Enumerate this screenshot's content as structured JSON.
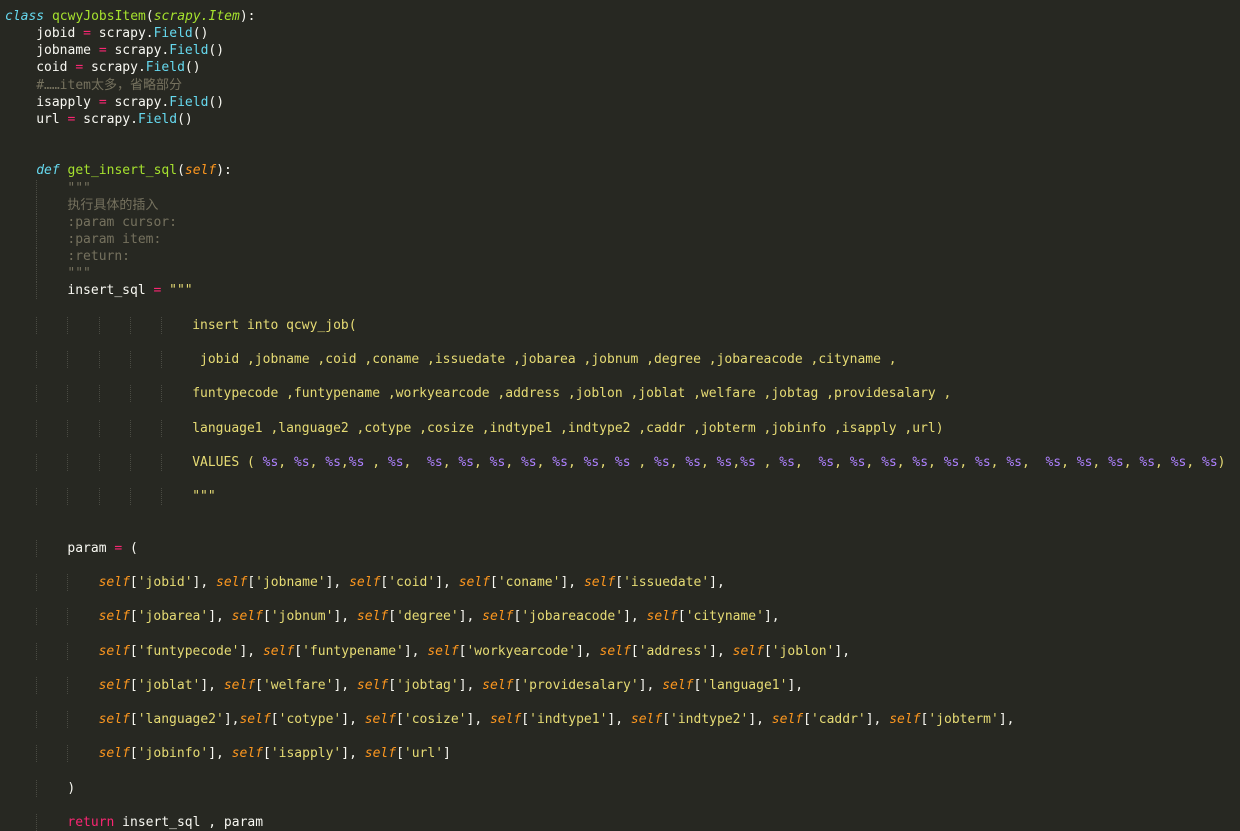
{
  "theme": {
    "background": "#272822",
    "foreground": "#f8f8f2",
    "keyword": "#66d9ef",
    "class_name": "#a6e22e",
    "operator": "#f92672",
    "comment": "#75715e",
    "self": "#fd971f",
    "string": "#e6db74",
    "format_spec": "#ae81ff"
  },
  "lines": [
    {
      "indent": 0,
      "tokens": [
        {
          "t": "class",
          "k": "kw"
        },
        {
          "t": " ",
          "k": "plain"
        },
        {
          "t": "qcwyJobsItem",
          "k": "cls"
        },
        {
          "t": "(",
          "k": "plain"
        },
        {
          "t": "scrapy.Item",
          "k": "base"
        },
        {
          "t": "):",
          "k": "plain"
        }
      ]
    },
    {
      "indent": 4,
      "tokens": [
        {
          "t": "jobid ",
          "k": "plain"
        },
        {
          "t": "=",
          "k": "op"
        },
        {
          "t": " scrapy.",
          "k": "plain"
        },
        {
          "t": "Field",
          "k": "call"
        },
        {
          "t": "()",
          "k": "plain"
        }
      ]
    },
    {
      "indent": 4,
      "tokens": [
        {
          "t": "jobname ",
          "k": "plain"
        },
        {
          "t": "=",
          "k": "op"
        },
        {
          "t": " scrapy.",
          "k": "plain"
        },
        {
          "t": "Field",
          "k": "call"
        },
        {
          "t": "()",
          "k": "plain"
        }
      ]
    },
    {
      "indent": 4,
      "tokens": [
        {
          "t": "coid ",
          "k": "plain"
        },
        {
          "t": "=",
          "k": "op"
        },
        {
          "t": " scrapy.",
          "k": "plain"
        },
        {
          "t": "Field",
          "k": "call"
        },
        {
          "t": "()",
          "k": "plain"
        }
      ]
    },
    {
      "indent": 4,
      "tokens": [
        {
          "t": "#……item太多，省略部分",
          "k": "cmt"
        }
      ]
    },
    {
      "indent": 4,
      "tokens": [
        {
          "t": "isapply ",
          "k": "plain"
        },
        {
          "t": "=",
          "k": "op"
        },
        {
          "t": " scrapy.",
          "k": "plain"
        },
        {
          "t": "Field",
          "k": "call"
        },
        {
          "t": "()",
          "k": "plain"
        }
      ]
    },
    {
      "indent": 4,
      "tokens": [
        {
          "t": "url ",
          "k": "plain"
        },
        {
          "t": "=",
          "k": "op"
        },
        {
          "t": " scrapy.",
          "k": "plain"
        },
        {
          "t": "Field",
          "k": "call"
        },
        {
          "t": "()",
          "k": "plain"
        }
      ]
    },
    {
      "indent": 0,
      "tokens": []
    },
    {
      "indent": 0,
      "tokens": []
    },
    {
      "indent": 4,
      "tokens": [
        {
          "t": "def",
          "k": "kw"
        },
        {
          "t": " ",
          "k": "plain"
        },
        {
          "t": "get_insert_sql",
          "k": "fn"
        },
        {
          "t": "(",
          "k": "plain"
        },
        {
          "t": "self",
          "k": "self"
        },
        {
          "t": "):",
          "k": "plain"
        }
      ]
    },
    {
      "indent": 8,
      "tokens": [
        {
          "t": "\"\"\"",
          "k": "doc"
        }
      ]
    },
    {
      "indent": 8,
      "tokens": [
        {
          "t": "执行具体的插入",
          "k": "doc"
        }
      ]
    },
    {
      "indent": 8,
      "tokens": [
        {
          "t": ":param cursor:",
          "k": "doc"
        }
      ]
    },
    {
      "indent": 8,
      "tokens": [
        {
          "t": ":param item:",
          "k": "doc"
        }
      ]
    },
    {
      "indent": 8,
      "tokens": [
        {
          "t": ":return:",
          "k": "doc"
        }
      ]
    },
    {
      "indent": 8,
      "tokens": [
        {
          "t": "\"\"\"",
          "k": "doc"
        }
      ]
    },
    {
      "indent": 8,
      "tokens": [
        {
          "t": "insert_sql ",
          "k": "plain"
        },
        {
          "t": "=",
          "k": "op"
        },
        {
          "t": " ",
          "k": "plain"
        },
        {
          "t": "\"\"\"",
          "k": "str"
        }
      ]
    },
    {
      "indent": 0,
      "tokens": []
    },
    {
      "indent": 24,
      "tokens": [
        {
          "t": "insert into qcwy_job(",
          "k": "str"
        }
      ]
    },
    {
      "indent": 0,
      "tokens": []
    },
    {
      "indent": 24,
      "tokens": [
        {
          "t": " jobid ,jobname ,coid ,coname ,issuedate ,jobarea ,jobnum ,degree ,jobareacode ,cityname ,",
          "k": "str"
        }
      ]
    },
    {
      "indent": 0,
      "tokens": []
    },
    {
      "indent": 24,
      "tokens": [
        {
          "t": "funtypecode ,funtypename ,workyearcode ,address ,joblon ,joblat ,welfare ,jobtag ,providesalary ,",
          "k": "str"
        }
      ]
    },
    {
      "indent": 0,
      "tokens": []
    },
    {
      "indent": 24,
      "tokens": [
        {
          "t": "language1 ,language2 ,cotype ,cosize ,indtype1 ,indtype2 ,caddr ,jobterm ,jobinfo ,isapply ,url)",
          "k": "str"
        }
      ]
    },
    {
      "indent": 0,
      "tokens": []
    },
    {
      "indent": 24,
      "tokens": [
        {
          "t": "VALUES ( ",
          "k": "str"
        },
        {
          "t": "%s",
          "k": "fmt"
        },
        {
          "t": ", ",
          "k": "str"
        },
        {
          "t": "%s",
          "k": "fmt"
        },
        {
          "t": ", ",
          "k": "str"
        },
        {
          "t": "%s",
          "k": "fmt"
        },
        {
          "t": ",",
          "k": "str"
        },
        {
          "t": "%s",
          "k": "fmt"
        },
        {
          "t": " , ",
          "k": "str"
        },
        {
          "t": "%s",
          "k": "fmt"
        },
        {
          "t": ",  ",
          "k": "str"
        },
        {
          "t": "%s",
          "k": "fmt"
        },
        {
          "t": ", ",
          "k": "str"
        },
        {
          "t": "%s",
          "k": "fmt"
        },
        {
          "t": ", ",
          "k": "str"
        },
        {
          "t": "%s",
          "k": "fmt"
        },
        {
          "t": ", ",
          "k": "str"
        },
        {
          "t": "%s",
          "k": "fmt"
        },
        {
          "t": ", ",
          "k": "str"
        },
        {
          "t": "%s",
          "k": "fmt"
        },
        {
          "t": ", ",
          "k": "str"
        },
        {
          "t": "%s",
          "k": "fmt"
        },
        {
          "t": ", ",
          "k": "str"
        },
        {
          "t": "%s",
          "k": "fmt"
        },
        {
          "t": " , ",
          "k": "str"
        },
        {
          "t": "%s",
          "k": "fmt"
        },
        {
          "t": ", ",
          "k": "str"
        },
        {
          "t": "%s",
          "k": "fmt"
        },
        {
          "t": ", ",
          "k": "str"
        },
        {
          "t": "%s",
          "k": "fmt"
        },
        {
          "t": ",",
          "k": "str"
        },
        {
          "t": "%s",
          "k": "fmt"
        },
        {
          "t": " , ",
          "k": "str"
        },
        {
          "t": "%s",
          "k": "fmt"
        },
        {
          "t": ",  ",
          "k": "str"
        },
        {
          "t": "%s",
          "k": "fmt"
        },
        {
          "t": ", ",
          "k": "str"
        },
        {
          "t": "%s",
          "k": "fmt"
        },
        {
          "t": ", ",
          "k": "str"
        },
        {
          "t": "%s",
          "k": "fmt"
        },
        {
          "t": ", ",
          "k": "str"
        },
        {
          "t": "%s",
          "k": "fmt"
        },
        {
          "t": ", ",
          "k": "str"
        },
        {
          "t": "%s",
          "k": "fmt"
        },
        {
          "t": ", ",
          "k": "str"
        },
        {
          "t": "%s",
          "k": "fmt"
        },
        {
          "t": ", ",
          "k": "str"
        },
        {
          "t": "%s",
          "k": "fmt"
        },
        {
          "t": ",  ",
          "k": "str"
        },
        {
          "t": "%s",
          "k": "fmt"
        },
        {
          "t": ", ",
          "k": "str"
        },
        {
          "t": "%s",
          "k": "fmt"
        },
        {
          "t": ", ",
          "k": "str"
        },
        {
          "t": "%s",
          "k": "fmt"
        },
        {
          "t": ", ",
          "k": "str"
        },
        {
          "t": "%s",
          "k": "fmt"
        },
        {
          "t": ", ",
          "k": "str"
        },
        {
          "t": "%s",
          "k": "fmt"
        },
        {
          "t": ", ",
          "k": "str"
        },
        {
          "t": "%s",
          "k": "fmt"
        },
        {
          "t": ")",
          "k": "str"
        }
      ]
    },
    {
      "indent": 0,
      "tokens": []
    },
    {
      "indent": 24,
      "tokens": [
        {
          "t": "\"\"\"",
          "k": "str"
        }
      ]
    },
    {
      "indent": 0,
      "tokens": []
    },
    {
      "indent": 0,
      "tokens": []
    },
    {
      "indent": 8,
      "tokens": [
        {
          "t": "param ",
          "k": "plain"
        },
        {
          "t": "=",
          "k": "op"
        },
        {
          "t": " (",
          "k": "plain"
        }
      ]
    },
    {
      "indent": 0,
      "tokens": []
    },
    {
      "indent": 12,
      "tokens": [
        {
          "t": "self",
          "k": "self"
        },
        {
          "t": "[",
          "k": "plain"
        },
        {
          "t": "'jobid'",
          "k": "str"
        },
        {
          "t": "], ",
          "k": "plain"
        },
        {
          "t": "self",
          "k": "self"
        },
        {
          "t": "[",
          "k": "plain"
        },
        {
          "t": "'jobname'",
          "k": "str"
        },
        {
          "t": "], ",
          "k": "plain"
        },
        {
          "t": "self",
          "k": "self"
        },
        {
          "t": "[",
          "k": "plain"
        },
        {
          "t": "'coid'",
          "k": "str"
        },
        {
          "t": "], ",
          "k": "plain"
        },
        {
          "t": "self",
          "k": "self"
        },
        {
          "t": "[",
          "k": "plain"
        },
        {
          "t": "'coname'",
          "k": "str"
        },
        {
          "t": "], ",
          "k": "plain"
        },
        {
          "t": "self",
          "k": "self"
        },
        {
          "t": "[",
          "k": "plain"
        },
        {
          "t": "'issuedate'",
          "k": "str"
        },
        {
          "t": "],",
          "k": "plain"
        }
      ]
    },
    {
      "indent": 0,
      "tokens": []
    },
    {
      "indent": 12,
      "tokens": [
        {
          "t": "self",
          "k": "self"
        },
        {
          "t": "[",
          "k": "plain"
        },
        {
          "t": "'jobarea'",
          "k": "str"
        },
        {
          "t": "], ",
          "k": "plain"
        },
        {
          "t": "self",
          "k": "self"
        },
        {
          "t": "[",
          "k": "plain"
        },
        {
          "t": "'jobnum'",
          "k": "str"
        },
        {
          "t": "], ",
          "k": "plain"
        },
        {
          "t": "self",
          "k": "self"
        },
        {
          "t": "[",
          "k": "plain"
        },
        {
          "t": "'degree'",
          "k": "str"
        },
        {
          "t": "], ",
          "k": "plain"
        },
        {
          "t": "self",
          "k": "self"
        },
        {
          "t": "[",
          "k": "plain"
        },
        {
          "t": "'jobareacode'",
          "k": "str"
        },
        {
          "t": "], ",
          "k": "plain"
        },
        {
          "t": "self",
          "k": "self"
        },
        {
          "t": "[",
          "k": "plain"
        },
        {
          "t": "'cityname'",
          "k": "str"
        },
        {
          "t": "],",
          "k": "plain"
        }
      ]
    },
    {
      "indent": 0,
      "tokens": []
    },
    {
      "indent": 12,
      "tokens": [
        {
          "t": "self",
          "k": "self"
        },
        {
          "t": "[",
          "k": "plain"
        },
        {
          "t": "'funtypecode'",
          "k": "str"
        },
        {
          "t": "], ",
          "k": "plain"
        },
        {
          "t": "self",
          "k": "self"
        },
        {
          "t": "[",
          "k": "plain"
        },
        {
          "t": "'funtypename'",
          "k": "str"
        },
        {
          "t": "], ",
          "k": "plain"
        },
        {
          "t": "self",
          "k": "self"
        },
        {
          "t": "[",
          "k": "plain"
        },
        {
          "t": "'workyearcode'",
          "k": "str"
        },
        {
          "t": "], ",
          "k": "plain"
        },
        {
          "t": "self",
          "k": "self"
        },
        {
          "t": "[",
          "k": "plain"
        },
        {
          "t": "'address'",
          "k": "str"
        },
        {
          "t": "], ",
          "k": "plain"
        },
        {
          "t": "self",
          "k": "self"
        },
        {
          "t": "[",
          "k": "plain"
        },
        {
          "t": "'joblon'",
          "k": "str"
        },
        {
          "t": "],",
          "k": "plain"
        }
      ]
    },
    {
      "indent": 0,
      "tokens": []
    },
    {
      "indent": 12,
      "tokens": [
        {
          "t": "self",
          "k": "self"
        },
        {
          "t": "[",
          "k": "plain"
        },
        {
          "t": "'joblat'",
          "k": "str"
        },
        {
          "t": "], ",
          "k": "plain"
        },
        {
          "t": "self",
          "k": "self"
        },
        {
          "t": "[",
          "k": "plain"
        },
        {
          "t": "'welfare'",
          "k": "str"
        },
        {
          "t": "], ",
          "k": "plain"
        },
        {
          "t": "self",
          "k": "self"
        },
        {
          "t": "[",
          "k": "plain"
        },
        {
          "t": "'jobtag'",
          "k": "str"
        },
        {
          "t": "], ",
          "k": "plain"
        },
        {
          "t": "self",
          "k": "self"
        },
        {
          "t": "[",
          "k": "plain"
        },
        {
          "t": "'providesalary'",
          "k": "str"
        },
        {
          "t": "], ",
          "k": "plain"
        },
        {
          "t": "self",
          "k": "self"
        },
        {
          "t": "[",
          "k": "plain"
        },
        {
          "t": "'language1'",
          "k": "str"
        },
        {
          "t": "],",
          "k": "plain"
        }
      ]
    },
    {
      "indent": 0,
      "tokens": []
    },
    {
      "indent": 12,
      "tokens": [
        {
          "t": "self",
          "k": "self"
        },
        {
          "t": "[",
          "k": "plain"
        },
        {
          "t": "'language2'",
          "k": "str"
        },
        {
          "t": "],",
          "k": "plain"
        },
        {
          "t": "self",
          "k": "self"
        },
        {
          "t": "[",
          "k": "plain"
        },
        {
          "t": "'cotype'",
          "k": "str"
        },
        {
          "t": "], ",
          "k": "plain"
        },
        {
          "t": "self",
          "k": "self"
        },
        {
          "t": "[",
          "k": "plain"
        },
        {
          "t": "'cosize'",
          "k": "str"
        },
        {
          "t": "], ",
          "k": "plain"
        },
        {
          "t": "self",
          "k": "self"
        },
        {
          "t": "[",
          "k": "plain"
        },
        {
          "t": "'indtype1'",
          "k": "str"
        },
        {
          "t": "], ",
          "k": "plain"
        },
        {
          "t": "self",
          "k": "self"
        },
        {
          "t": "[",
          "k": "plain"
        },
        {
          "t": "'indtype2'",
          "k": "str"
        },
        {
          "t": "], ",
          "k": "plain"
        },
        {
          "t": "self",
          "k": "self"
        },
        {
          "t": "[",
          "k": "plain"
        },
        {
          "t": "'caddr'",
          "k": "str"
        },
        {
          "t": "], ",
          "k": "plain"
        },
        {
          "t": "self",
          "k": "self"
        },
        {
          "t": "[",
          "k": "plain"
        },
        {
          "t": "'jobterm'",
          "k": "str"
        },
        {
          "t": "],",
          "k": "plain"
        }
      ]
    },
    {
      "indent": 0,
      "tokens": []
    },
    {
      "indent": 12,
      "tokens": [
        {
          "t": "self",
          "k": "self"
        },
        {
          "t": "[",
          "k": "plain"
        },
        {
          "t": "'jobinfo'",
          "k": "str"
        },
        {
          "t": "], ",
          "k": "plain"
        },
        {
          "t": "self",
          "k": "self"
        },
        {
          "t": "[",
          "k": "plain"
        },
        {
          "t": "'isapply'",
          "k": "str"
        },
        {
          "t": "], ",
          "k": "plain"
        },
        {
          "t": "self",
          "k": "self"
        },
        {
          "t": "[",
          "k": "plain"
        },
        {
          "t": "'url'",
          "k": "str"
        },
        {
          "t": "]",
          "k": "plain"
        }
      ]
    },
    {
      "indent": 0,
      "tokens": []
    },
    {
      "indent": 8,
      "tokens": [
        {
          "t": ")",
          "k": "plain"
        }
      ]
    },
    {
      "indent": 0,
      "tokens": []
    },
    {
      "indent": 8,
      "tokens": [
        {
          "t": "return",
          "k": "ret"
        },
        {
          "t": " insert_sql , param",
          "k": "plain"
        }
      ]
    }
  ]
}
